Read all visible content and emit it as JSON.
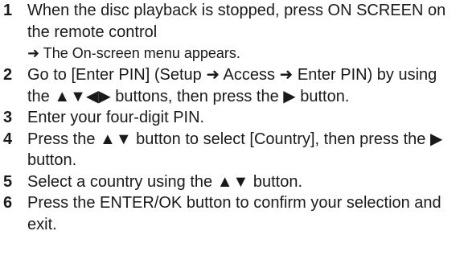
{
  "steps": [
    {
      "number": "1",
      "text": "When the disc playback is stopped, press ON SCREEN on the remote control",
      "result": "➜ The On-screen menu appears."
    },
    {
      "number": "2",
      "text": "Go to [Enter PIN] (Setup ➜ Access ➜ Enter PIN) by using the ▲▼◀▶ buttons, then press the ▶ button."
    },
    {
      "number": "3",
      "text": "Enter your four-digit PIN."
    },
    {
      "number": "4",
      "text": "Press the ▲▼ button to select [Country], then press the ▶ button."
    },
    {
      "number": "5",
      "text": "Select a country using the ▲▼ button."
    },
    {
      "number": "6",
      "text": "Press the ENTER/OK button to confirm your selection and exit."
    }
  ]
}
